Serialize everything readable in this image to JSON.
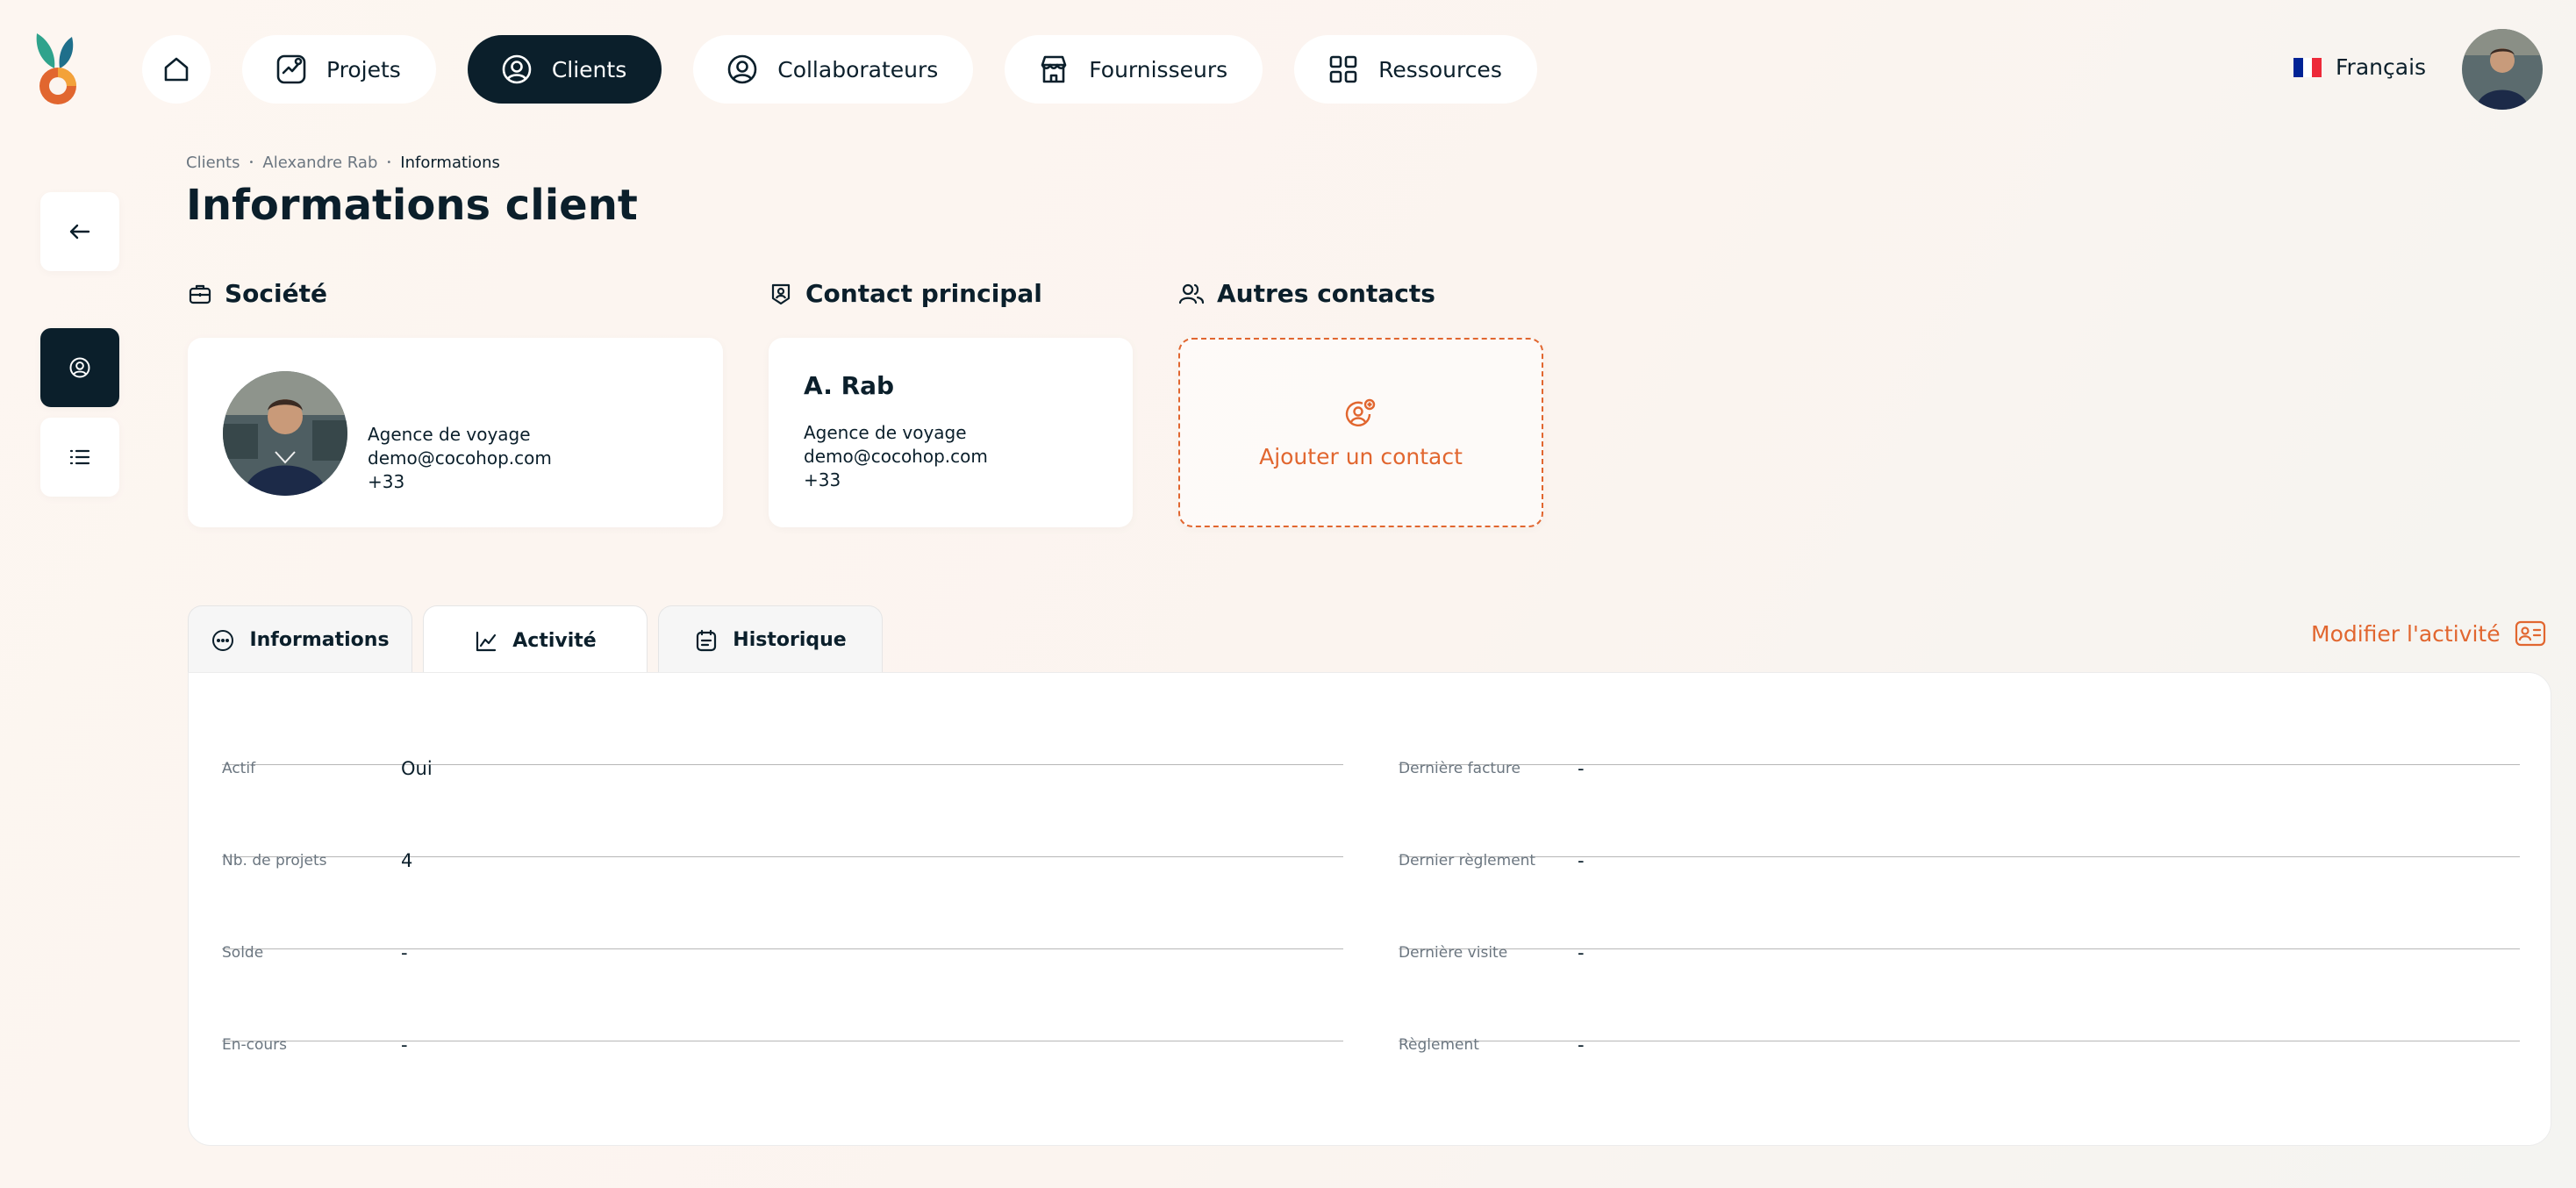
{
  "nav": {
    "home_label": "",
    "items": [
      {
        "label": "Projets",
        "icon": "projects-icon"
      },
      {
        "label": "Clients",
        "icon": "user-circle-icon",
        "active": true
      },
      {
        "label": "Collaborateurs",
        "icon": "user-circle-icon"
      },
      {
        "label": "Fournisseurs",
        "icon": "store-icon"
      },
      {
        "label": "Ressources",
        "icon": "grid-icon"
      }
    ]
  },
  "language": {
    "label": "Français",
    "flag_colors": [
      "#002395",
      "#ffffff",
      "#ed2939"
    ]
  },
  "breadcrumb": {
    "items": [
      "Clients",
      "Alexandre Rab",
      "Informations"
    ]
  },
  "page_title": "Informations client",
  "societe": {
    "title": "Société",
    "lines": [
      "Agence de voyage",
      "demo@cocohop.com",
      "+33"
    ]
  },
  "contact_principal": {
    "title": "Contact principal",
    "name": "A. Rab",
    "lines": [
      "Agence de voyage",
      "demo@cocohop.com",
      "+33"
    ]
  },
  "autres_contacts": {
    "title": "Autres contacts",
    "add_label": "Ajouter un contact"
  },
  "tabs": [
    {
      "label": "Informations",
      "icon": "dots-circle-icon"
    },
    {
      "label": "Activité",
      "icon": "chart-line-icon",
      "active": true
    },
    {
      "label": "Historique",
      "icon": "calendar-list-icon"
    }
  ],
  "modify_label": "Modifier l'activité",
  "activity": {
    "left": [
      {
        "label": "Actif",
        "value": "Oui"
      },
      {
        "label": "Nb. de projets",
        "value": "4"
      },
      {
        "label": "Solde",
        "value": "-"
      },
      {
        "label": "En-cours",
        "value": "-"
      }
    ],
    "right": [
      {
        "label": "Dernière facture",
        "value": "-"
      },
      {
        "label": "Dernier règlement",
        "value": "-"
      },
      {
        "label": "Dernière visite",
        "value": "-"
      },
      {
        "label": "Règlement",
        "value": "-"
      }
    ]
  },
  "colors": {
    "accent": "#e1662f",
    "dark": "#0b1f2b",
    "page_bg": "#fbf4ef"
  }
}
